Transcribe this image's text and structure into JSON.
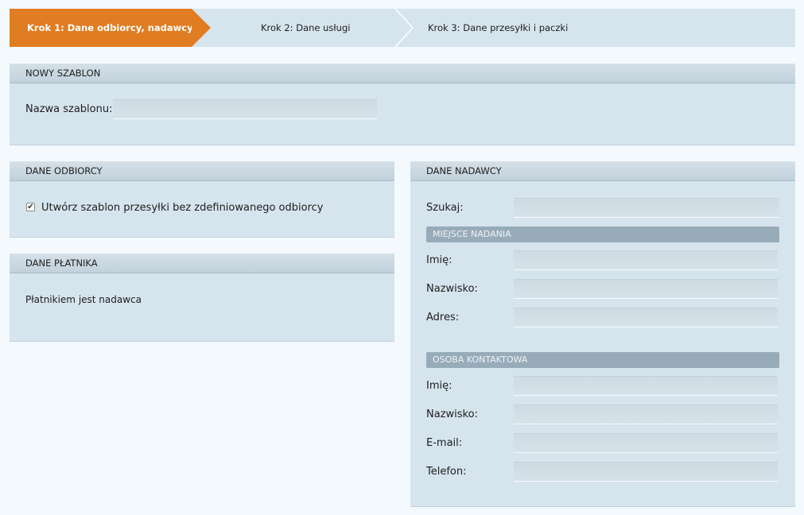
{
  "steps": [
    {
      "label": "Krok 1: Dane odbiorcy, nadawcy,"
    },
    {
      "label": "Krok 2: Dane usługi"
    },
    {
      "label": "Krok 3: Dane przesyłki i paczki"
    }
  ],
  "template": {
    "header": "NOWY SZABLON",
    "name_label": "Nazwa szablonu:",
    "name_value": ""
  },
  "recipient": {
    "header": "DANE ODBIORCY",
    "checkbox_label": "Utwórz szablon przesyłki bez zdefiniowanego odbiorcy",
    "checkbox_checked": true,
    "check_glyph": "✔"
  },
  "payer": {
    "header": "DANE PŁATNIKA",
    "text": "Płatnikiem jest nadawca"
  },
  "sender": {
    "header": "DANE NADAWCY",
    "search_label": "Szukaj:",
    "place_header": "MIEJSCE NADANIA",
    "place_fields": [
      {
        "label": "Imię:"
      },
      {
        "label": "Nazwisko:"
      },
      {
        "label": "Adres:"
      }
    ],
    "contact_header": "OSOBA KONTAKTOWA",
    "contact_fields": [
      {
        "label": "Imię:"
      },
      {
        "label": "Nazwisko:"
      },
      {
        "label": "E-mail:"
      },
      {
        "label": "Telefon:"
      }
    ]
  },
  "colors": {
    "active_step": "#e07d22",
    "panel_bg": "#d6e4ee",
    "subheader_bg": "#97abb9"
  }
}
